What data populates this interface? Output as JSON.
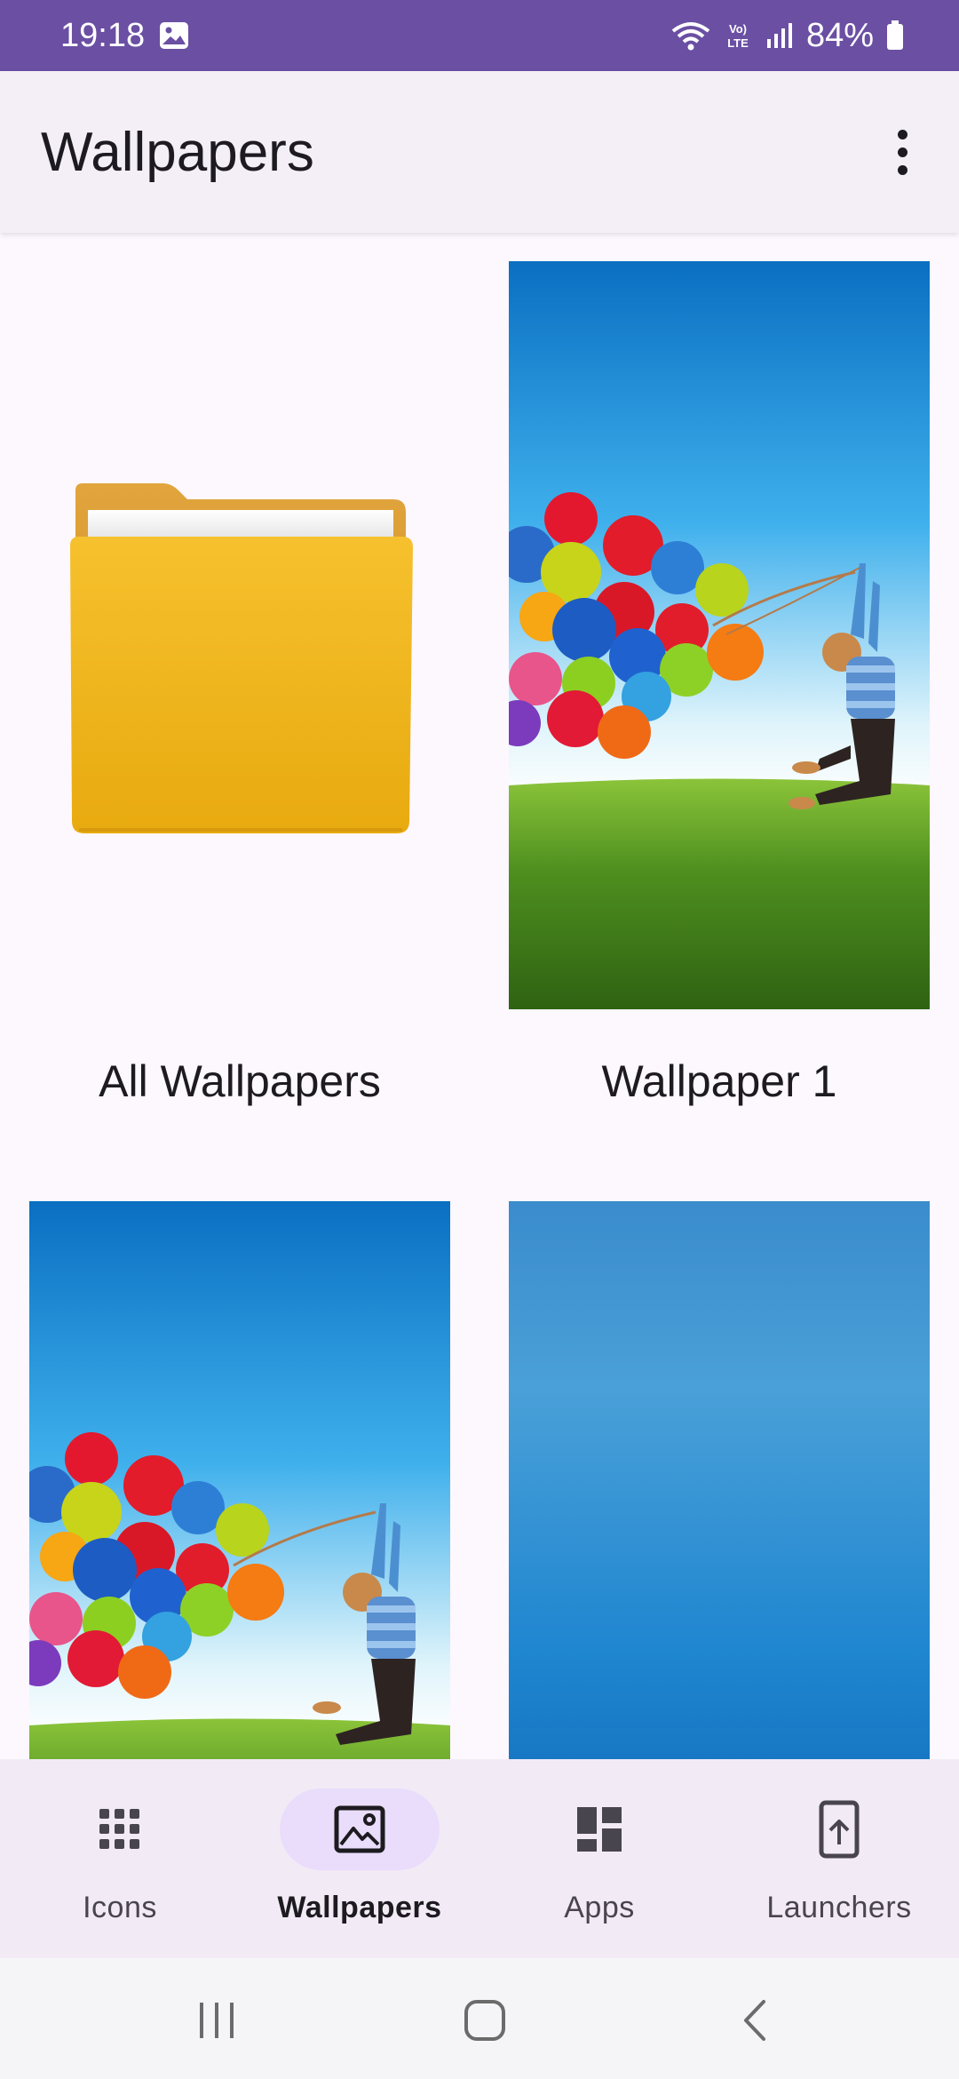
{
  "status_bar": {
    "time": "19:18",
    "battery": "84%",
    "icons": [
      "image-notification-icon",
      "wifi-icon",
      "volte-icon",
      "signal-icon",
      "battery-icon"
    ]
  },
  "app_bar": {
    "title": "Wallpapers",
    "more_icon": "more-vert-icon"
  },
  "grid": {
    "items": [
      {
        "label": "All Wallpapers",
        "kind": "folder"
      },
      {
        "label": "Wallpaper 1",
        "kind": "balloons"
      },
      {
        "label": "",
        "kind": "balloons"
      },
      {
        "label": "",
        "kind": "blue-gradient"
      }
    ]
  },
  "bottom_nav": {
    "items": [
      {
        "label": "Icons",
        "icon": "apps-grid-icon",
        "active": false
      },
      {
        "label": "Wallpapers",
        "icon": "image-icon",
        "active": true
      },
      {
        "label": "Apps",
        "icon": "dashboard-icon",
        "active": false
      },
      {
        "label": "Launchers",
        "icon": "install-mobile-icon",
        "active": false
      }
    ]
  },
  "system_nav": {
    "buttons": [
      "recents-icon",
      "home-icon",
      "back-icon"
    ]
  },
  "colors": {
    "status_bar": "#6a4fa3",
    "app_bar": "#f4eff7",
    "background": "#fdf7fe",
    "nav_active_pill": "#e9ddfb",
    "folder_yellow": "#f2b51c"
  }
}
